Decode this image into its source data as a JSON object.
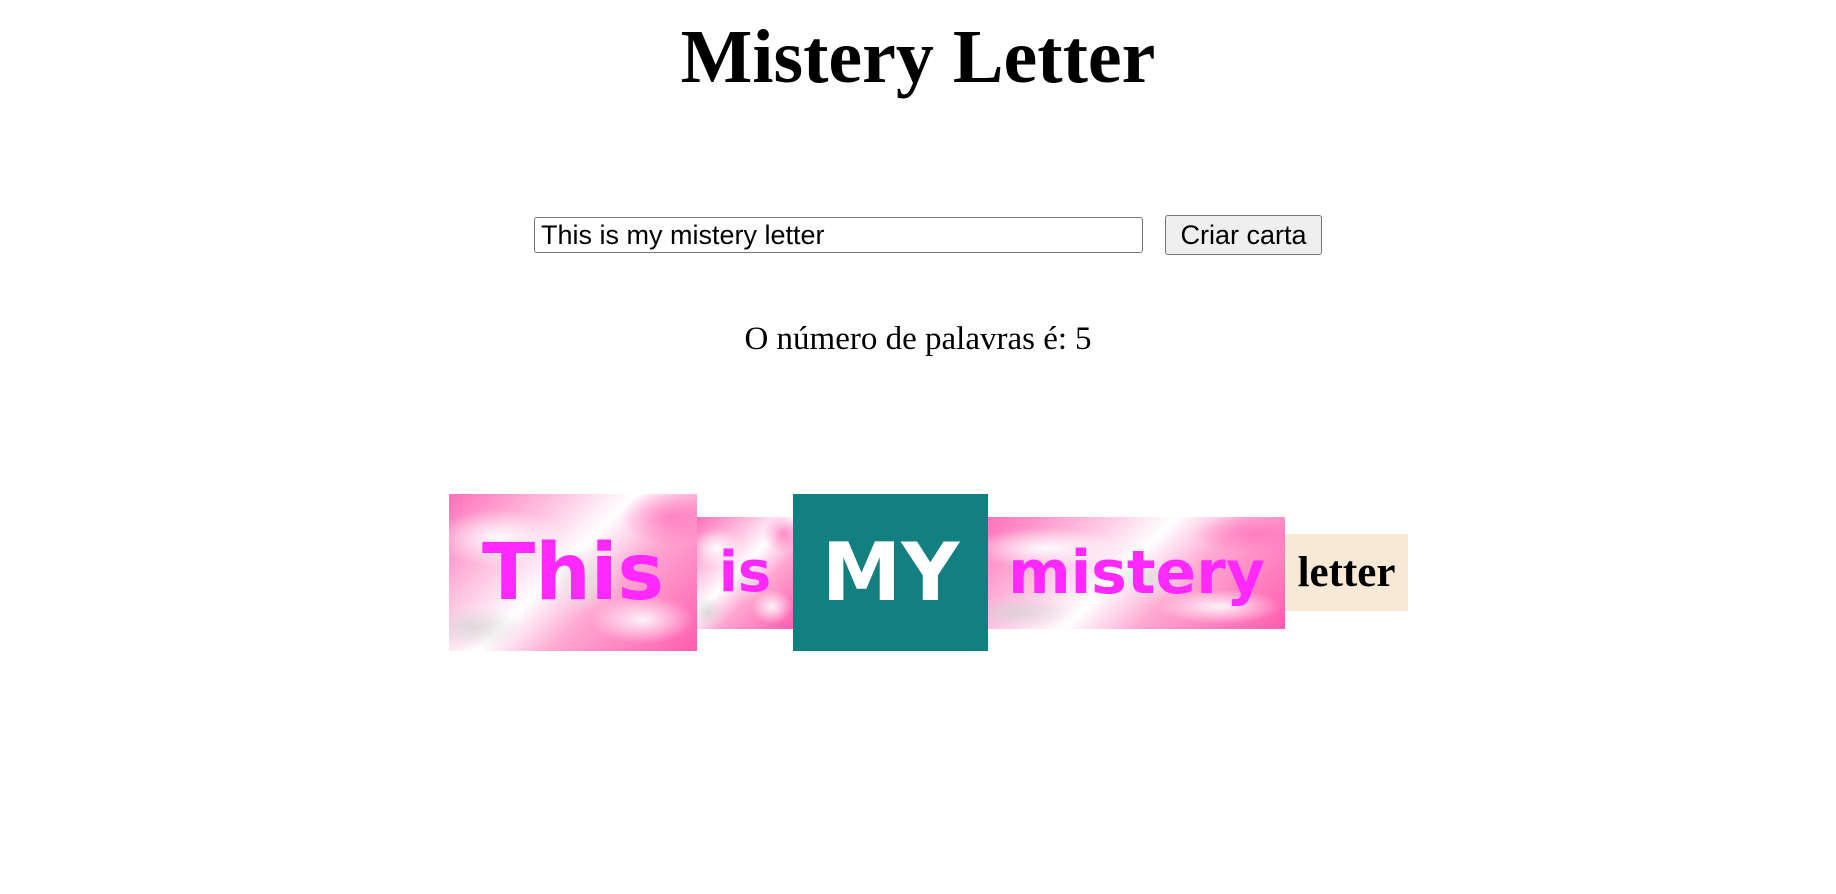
{
  "page": {
    "title": "Mistery Letter"
  },
  "form": {
    "input_value": "This is my mistery letter",
    "button_label": "Criar carta"
  },
  "word_count": {
    "label": "O número de palavras é:",
    "value": "5"
  },
  "letter": {
    "words": [
      {
        "text": "This",
        "style": "pink-paper"
      },
      {
        "text": "is",
        "style": "pink-paper"
      },
      {
        "text": "MY",
        "style": "teal-box"
      },
      {
        "text": "mistery",
        "style": "pink-paper"
      },
      {
        "text": "letter",
        "style": "beige-box"
      }
    ]
  },
  "colors": {
    "magenta_text": "#ff28ff",
    "teal_box": "#128080",
    "beige_box": "#f8e8d6",
    "pink_paper": "#ff6fb9"
  }
}
